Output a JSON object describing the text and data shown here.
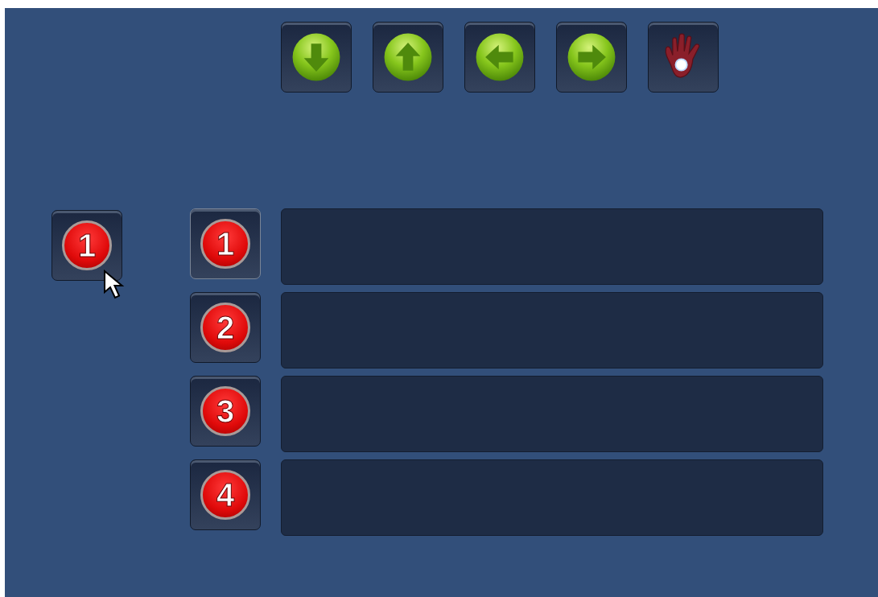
{
  "toolbar": [
    {
      "kind": "down"
    },
    {
      "kind": "up"
    },
    {
      "kind": "left"
    },
    {
      "kind": "right"
    },
    {
      "kind": "hand"
    }
  ],
  "dragged_item": {
    "label": "1"
  },
  "slots": [
    {
      "label": "1",
      "selected": true
    },
    {
      "label": "2",
      "selected": false
    },
    {
      "label": "3",
      "selected": false
    },
    {
      "label": "4",
      "selected": false
    }
  ]
}
